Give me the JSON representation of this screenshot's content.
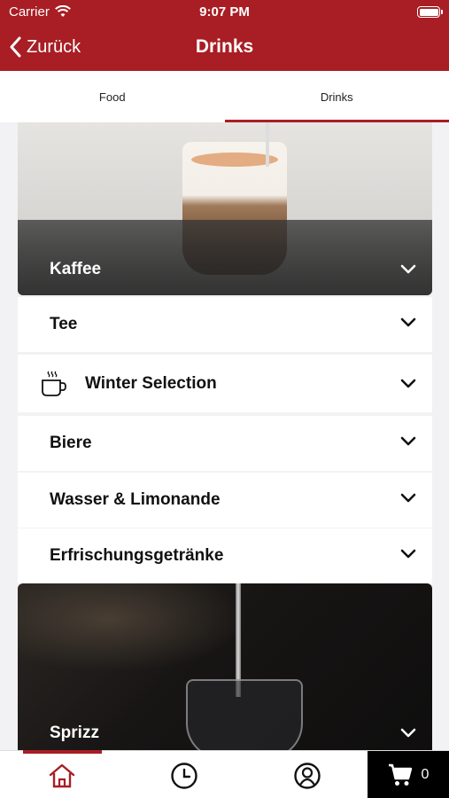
{
  "status_bar": {
    "carrier": "Carrier",
    "time": "9:07 PM"
  },
  "nav": {
    "back_label": "Zurück",
    "title": "Drinks"
  },
  "tabs": [
    {
      "label": "Food",
      "active": false
    },
    {
      "label": "Drinks",
      "active": true
    }
  ],
  "categories": {
    "kaffee": "Kaffee",
    "tee": "Tee",
    "winter": "Winter Selection",
    "biere": "Biere",
    "wasser": "Wasser & Limonande",
    "erfrischung": "Erfrischungsgetränke",
    "sprizz": "Sprizz"
  },
  "icons": {
    "back": "chevron-left-icon",
    "expand": "chevron-down-icon",
    "winter": "hot-cup-icon",
    "home": "home-icon",
    "history": "clock-icon",
    "profile": "user-icon",
    "cart": "cart-icon"
  },
  "cart": {
    "count": "0"
  },
  "colors": {
    "brand": "#a81e24",
    "active_tab": "#a81e24",
    "cart_bg": "#000000"
  }
}
